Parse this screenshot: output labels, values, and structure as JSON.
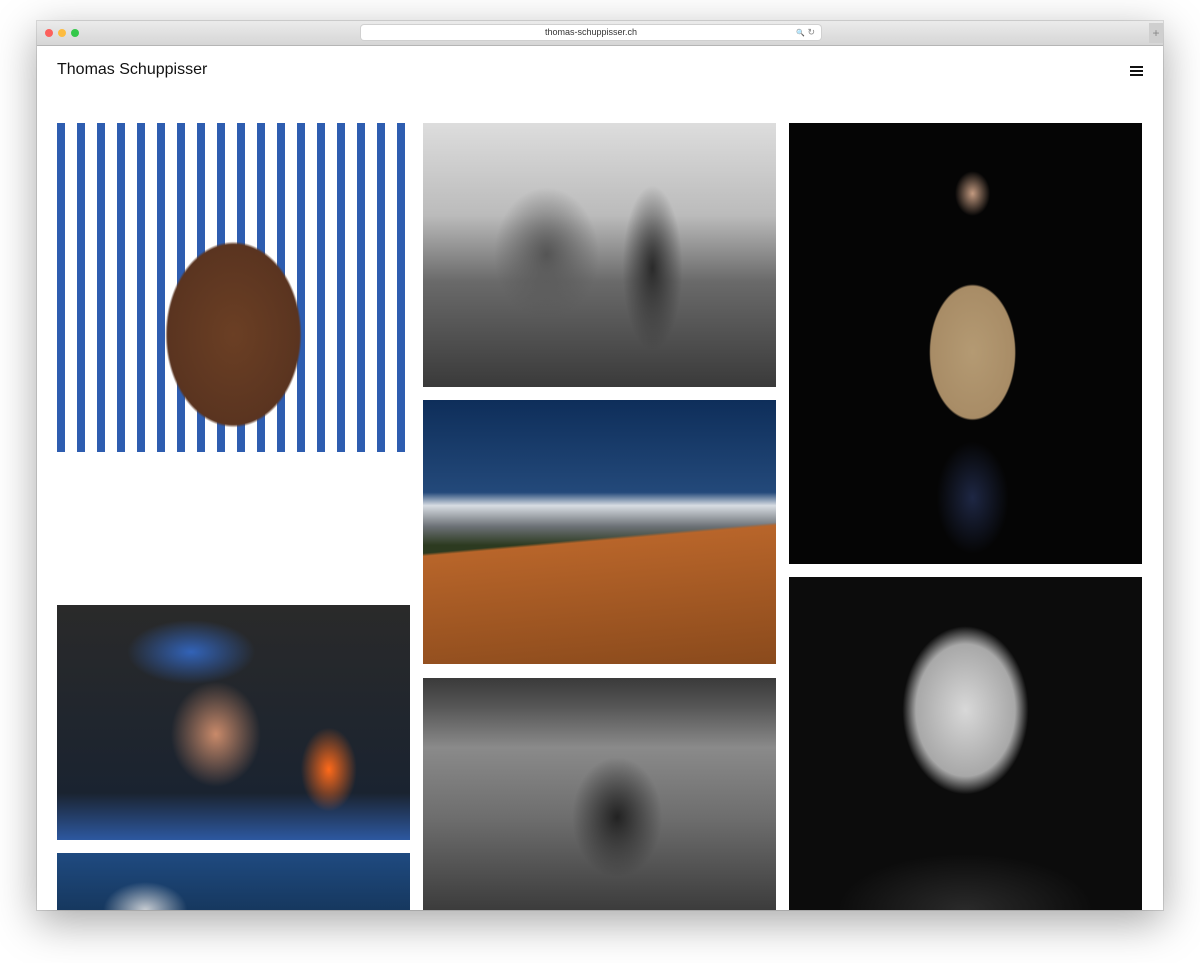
{
  "browser": {
    "url": "thomas-schuppisser.ch",
    "new_tab": "+",
    "search_icon": "🔍",
    "reload_icon": "↻"
  },
  "site": {
    "title": "Thomas Schuppisser",
    "menu_icon": "hamburger-icon"
  },
  "gallery": [
    {
      "name": "photo-boy-portrait"
    },
    {
      "name": "photo-worker-helmet"
    },
    {
      "name": "photo-machine-blue"
    },
    {
      "name": "photo-tree-landscape"
    },
    {
      "name": "photo-mountains-cow"
    },
    {
      "name": "photo-family-room"
    },
    {
      "name": "photo-scout-uniform"
    },
    {
      "name": "photo-older-man"
    }
  ]
}
